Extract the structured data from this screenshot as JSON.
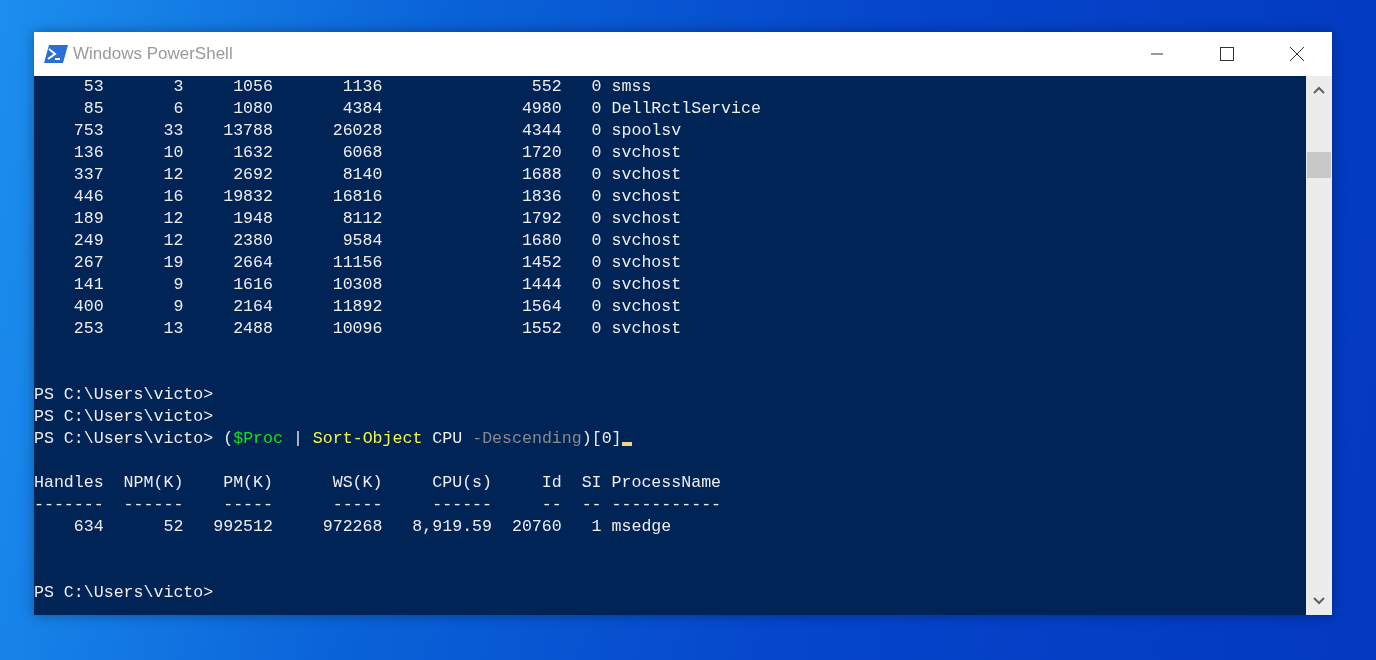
{
  "window": {
    "title": "Windows PowerShell"
  },
  "console": {
    "lines": [
      {
        "kind": "row",
        "cells": [
          "53",
          "3",
          "1056",
          "1136",
          "",
          "552",
          "0",
          "smss"
        ]
      },
      {
        "kind": "row",
        "cells": [
          "85",
          "6",
          "1080",
          "4384",
          "",
          "4980",
          "0",
          "DellRctlService"
        ]
      },
      {
        "kind": "row",
        "cells": [
          "753",
          "33",
          "13788",
          "26028",
          "",
          "4344",
          "0",
          "spoolsv"
        ]
      },
      {
        "kind": "row",
        "cells": [
          "136",
          "10",
          "1632",
          "6068",
          "",
          "1720",
          "0",
          "svchost"
        ]
      },
      {
        "kind": "row",
        "cells": [
          "337",
          "12",
          "2692",
          "8140",
          "",
          "1688",
          "0",
          "svchost"
        ]
      },
      {
        "kind": "row",
        "cells": [
          "446",
          "16",
          "19832",
          "16816",
          "",
          "1836",
          "0",
          "svchost"
        ]
      },
      {
        "kind": "row",
        "cells": [
          "189",
          "12",
          "1948",
          "8112",
          "",
          "1792",
          "0",
          "svchost"
        ]
      },
      {
        "kind": "row",
        "cells": [
          "249",
          "12",
          "2380",
          "9584",
          "",
          "1680",
          "0",
          "svchost"
        ]
      },
      {
        "kind": "row",
        "cells": [
          "267",
          "19",
          "2664",
          "11156",
          "",
          "1452",
          "0",
          "svchost"
        ]
      },
      {
        "kind": "row",
        "cells": [
          "141",
          "9",
          "1616",
          "10308",
          "",
          "1444",
          "0",
          "svchost"
        ]
      },
      {
        "kind": "row",
        "cells": [
          "400",
          "9",
          "2164",
          "11892",
          "",
          "1564",
          "0",
          "svchost"
        ]
      },
      {
        "kind": "row",
        "cells": [
          "253",
          "13",
          "2488",
          "10096",
          "",
          "1552",
          "0",
          "svchost"
        ]
      },
      {
        "kind": "blank"
      },
      {
        "kind": "blank"
      },
      {
        "kind": "prompt",
        "prompt": "PS C:\\Users\\victo>"
      },
      {
        "kind": "prompt",
        "prompt": "PS C:\\Users\\victo>"
      },
      {
        "kind": "command",
        "prompt": "PS C:\\Users\\victo>",
        "cursor": true,
        "segments": [
          {
            "kind": "plain",
            "text": " ("
          },
          {
            "kind": "variable",
            "text": "$Proc"
          },
          {
            "kind": "plain",
            "text": " | "
          },
          {
            "kind": "cmdlet",
            "text": "Sort-Object"
          },
          {
            "kind": "plain",
            "text": " CPU "
          },
          {
            "kind": "parameter",
            "text": "-Descending"
          },
          {
            "kind": "plain",
            "text": ")[0]"
          }
        ]
      },
      {
        "kind": "blank"
      },
      {
        "kind": "header",
        "cells": [
          "Handles",
          "NPM(K)",
          "PM(K)",
          "WS(K)",
          "CPU(s)",
          "Id",
          "SI",
          "ProcessName"
        ]
      },
      {
        "kind": "rule",
        "cells": [
          "-------",
          "------",
          "-----",
          "-----",
          "------",
          "--",
          "--",
          "-----------"
        ]
      },
      {
        "kind": "row",
        "cells": [
          "634",
          "52",
          "992512",
          "972268",
          "8,919.59",
          "20760",
          "1",
          "msedge"
        ]
      },
      {
        "kind": "blank"
      },
      {
        "kind": "blank"
      },
      {
        "kind": "prompt",
        "prompt": "PS C:\\Users\\victo>"
      }
    ]
  }
}
